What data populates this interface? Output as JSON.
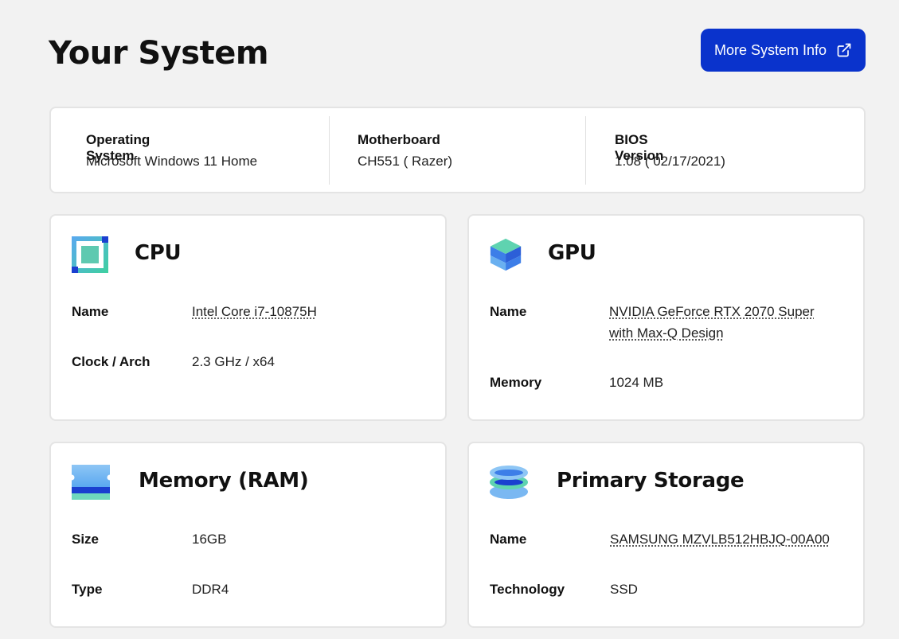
{
  "header": {
    "title": "Your System",
    "more_button": "More System Info"
  },
  "system": {
    "os_label": "Operating System",
    "os_value": "Microsoft Windows 11 Home",
    "mb_label": "Motherboard",
    "mb_value": "CH551 ( Razer)",
    "bios_label": "BIOS Version",
    "bios_value": "1.08 ( 02/17/2021)"
  },
  "cpu": {
    "title": "CPU",
    "icon": "cpu-icon",
    "rows": [
      {
        "label": "Name",
        "value": "Intel Core i7-10875H"
      },
      {
        "label": "Clock / Arch",
        "value": "2.3 GHz / x64"
      }
    ]
  },
  "gpu": {
    "title": "GPU",
    "icon": "gpu-icon",
    "rows": [
      {
        "label": "Name",
        "value_line1": "NVIDIA GeForce RTX 2070 Super",
        "value_line2": "with Max-Q Design"
      },
      {
        "label": "Memory",
        "value": "1024 MB"
      }
    ]
  },
  "ram": {
    "title": "Memory (RAM)",
    "icon": "ram-icon",
    "rows": [
      {
        "label": "Size",
        "value": "16GB"
      },
      {
        "label": "Type",
        "value": "DDR4"
      }
    ]
  },
  "storage": {
    "title": "Primary Storage",
    "icon": "storage-icon",
    "rows": [
      {
        "label": "Name",
        "value": "SAMSUNG MZVLB512HBJQ-00A00"
      },
      {
        "label": "Technology",
        "value": "SSD"
      }
    ]
  },
  "colors": {
    "accent": "#0a33cc",
    "background": "#f2f2f2",
    "card": "#ffffff"
  }
}
